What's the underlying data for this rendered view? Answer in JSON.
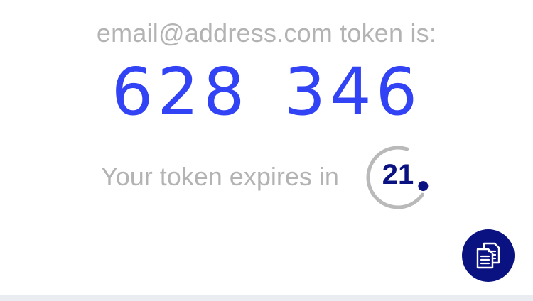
{
  "account": {
    "label": "email@address.com token is:"
  },
  "token": {
    "code": "628 346"
  },
  "expiry": {
    "label": "Your token expires in",
    "seconds_remaining": "21",
    "ring_fraction": 0.7
  },
  "copy_button": {
    "icon": "copy-icon"
  },
  "colors": {
    "token": "#3242f5",
    "accent": "#0a1180",
    "muted_text": "#b3b3b3",
    "ring_track": "#b9b9b9"
  }
}
